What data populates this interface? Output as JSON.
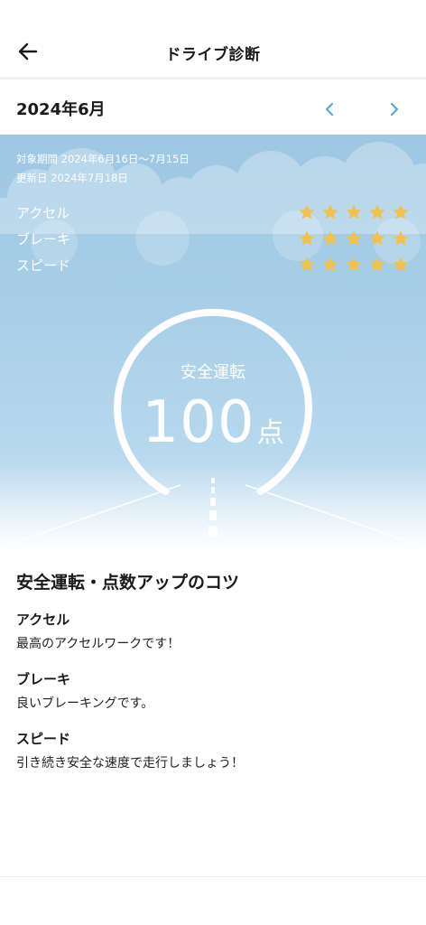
{
  "header": {
    "title": "ドライブ診断",
    "back_icon": "arrow-left-icon"
  },
  "month_nav": {
    "label": "2024年6月",
    "prev_icon": "chevron-left-icon",
    "next_icon": "chevron-right-icon",
    "accent": "#5aa6d6"
  },
  "summary": {
    "period": "対象期間 2024年6月16日〜7月15日",
    "updated": "更新日 2024年7月18日",
    "ratings": [
      {
        "label": "アクセル",
        "stars": 5,
        "max_stars": 5
      },
      {
        "label": "ブレーキ",
        "stars": 5,
        "max_stars": 5
      },
      {
        "label": "スピード",
        "stars": 5,
        "max_stars": 5
      }
    ],
    "star_color": "#f0c24a",
    "score_title": "安全運転",
    "score_value": "100",
    "score_unit": "点",
    "score_fraction": 1.0
  },
  "tips": {
    "heading": "安全運転・点数アップのコツ",
    "items": [
      {
        "title": "アクセル",
        "body": "最高のアクセルワークです！"
      },
      {
        "title": "ブレーキ",
        "body": "良いブレーキングです。"
      },
      {
        "title": "スピード",
        "body": "引き続き安全な速度で走行しましょう！"
      }
    ]
  }
}
